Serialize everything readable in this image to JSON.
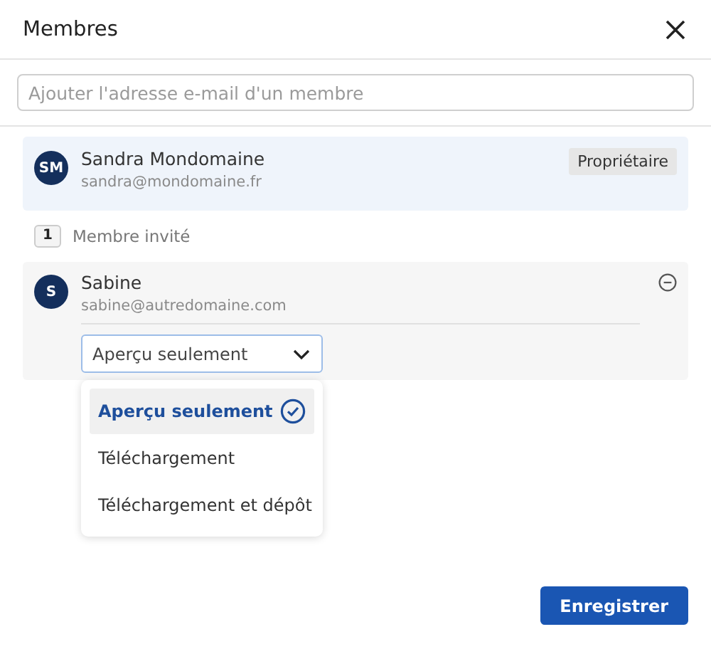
{
  "dialog": {
    "title": "Membres"
  },
  "add_field": {
    "placeholder": "Ajouter l'adresse e-mail d'un membre"
  },
  "owner": {
    "initials": "SM",
    "name": "Sandra Mondomaine",
    "email": "sandra@mondomaine.fr",
    "role": "Propriétaire"
  },
  "invited_count": "1",
  "invited_label": "Membre invité",
  "invited": [
    {
      "initials": "S",
      "name": "Sabine",
      "email": "sabine@autredomaine.com",
      "permission": "Aperçu seulement",
      "expanded": true,
      "options": [
        {
          "label": "Aperçu seulement",
          "selected": true
        },
        {
          "label": "Téléchargement",
          "selected": false
        },
        {
          "label": "Téléchargement et dépôt",
          "selected": false
        }
      ]
    }
  ],
  "save_button": "Enregistrer"
}
